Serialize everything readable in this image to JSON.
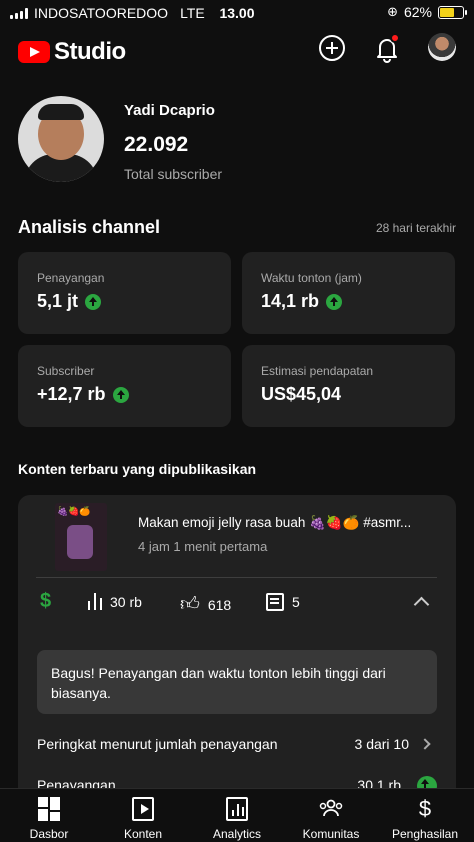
{
  "status_bar": {
    "carrier": "INDOSATOOREDOO",
    "network": "LTE",
    "time": "13.00",
    "battery": "62%",
    "battery_level": 0.62,
    "battery_color": "#f2d21a"
  },
  "header": {
    "app_name": "Studio",
    "brand_color": "#ff0000",
    "icons": [
      "create-icon",
      "notification-bell-icon",
      "account-avatar"
    ]
  },
  "channel": {
    "name": "Yadi Dcaprio",
    "subscriber_count": "22.092",
    "subscriber_label": "Total subscriber"
  },
  "analytics": {
    "title": "Analisis channel",
    "range": "28 hari terakhir",
    "accent_color": "#2ba640",
    "cards": [
      {
        "label": "Penayangan",
        "value": "5,1 jt",
        "trend": "up"
      },
      {
        "label": "Waktu tonton (jam)",
        "value": "14,1 rb",
        "trend": "up"
      },
      {
        "label": "Subscriber",
        "value": "+12,7 rb",
        "trend": "up"
      },
      {
        "label": "Estimasi pendapatan",
        "value": "US$45,04",
        "trend": "none"
      }
    ]
  },
  "latest": {
    "title": "Konten terbaru yang dipublikasikan",
    "video": {
      "title": "Makan emoji jelly rasa buah 🍇🍓🍊 #asmr...",
      "meta": "4 jam 1 menit pertama",
      "thumbnail_emojis": "🍇🍓🍊",
      "views": "30 rb",
      "likes": "618",
      "comments": "5"
    },
    "insight": "Bagus! Penayangan dan waktu tonton lebih tinggi dari biasanya.",
    "rank_label": "Peringkat menurut jumlah penayangan",
    "rank_value": "3 dari 10",
    "views_label": "Penayangan",
    "views_value": "30,1 rb"
  },
  "bottom_nav": [
    {
      "label": "Dasbor",
      "icon": "dashboard-icon"
    },
    {
      "label": "Konten",
      "icon": "content-icon"
    },
    {
      "label": "Analytics",
      "icon": "analytics-icon"
    },
    {
      "label": "Komunitas",
      "icon": "community-icon"
    },
    {
      "label": "Penghasilan",
      "icon": "earnings-icon"
    }
  ]
}
